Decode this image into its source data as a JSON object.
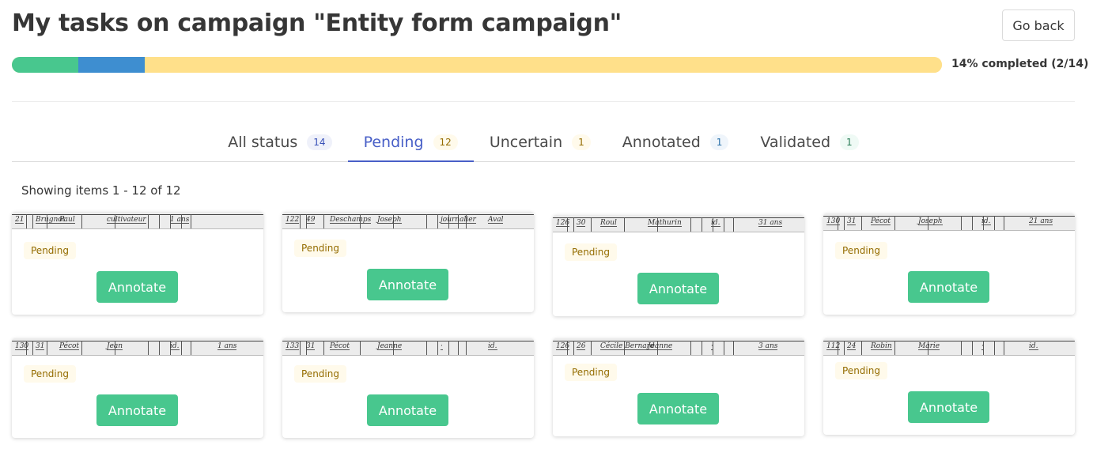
{
  "header": {
    "title": "My tasks on campaign \"Entity form campaign\"",
    "go_back_label": "Go back"
  },
  "progress": {
    "label": "14% completed (2/14)",
    "segments": [
      {
        "status": "validated",
        "count": 1,
        "color": "#48c78e"
      },
      {
        "status": "annotated",
        "count": 1,
        "color": "#3e8ed0"
      },
      {
        "status": "pending",
        "count": 12,
        "color": "#ffe08a"
      }
    ]
  },
  "tabs": [
    {
      "label": "All status",
      "count": "14",
      "active": false,
      "count_bg": "#eff1fa",
      "count_color": "#3850b7"
    },
    {
      "label": "Pending",
      "count": "12",
      "active": true,
      "count_bg": "#fffaeb",
      "count_color": "#946c00"
    },
    {
      "label": "Uncertain",
      "count": "1",
      "active": false,
      "count_bg": "#fffaeb",
      "count_color": "#946c00"
    },
    {
      "label": "Annotated",
      "count": "1",
      "active": false,
      "count_bg": "#eff5fb",
      "count_color": "#296fa8"
    },
    {
      "label": "Validated",
      "count": "1",
      "active": false,
      "count_bg": "#effaf5",
      "count_color": "#257953"
    }
  ],
  "showing_text": "Showing items 1 - 12 of 12",
  "cards": [
    {
      "thumb_text": [
        "21",
        "Brugnot",
        "Paul",
        "cultivateur",
        "1 ans"
      ],
      "status": "Pending",
      "button": "Annotate"
    },
    {
      "thumb_text": [
        "122",
        "49",
        "Deschamps",
        "Joseph",
        "journalier",
        "Aval"
      ],
      "status": "Pending",
      "button": "Annotate"
    },
    {
      "thumb_text": [
        "126",
        "30",
        "Roul",
        "Mathurin",
        "id.",
        "31 ans"
      ],
      "status": "Pending",
      "button": "Annotate"
    },
    {
      "thumb_text": [
        "130",
        "31",
        "Pécot",
        "Joseph",
        "id.",
        "21 ans"
      ],
      "status": "Pending",
      "button": "Annotate"
    },
    {
      "thumb_text": [
        "130",
        "31",
        "Pécot",
        "Jean",
        "id.",
        "1 ans"
      ],
      "status": "Pending",
      "button": "Annotate"
    },
    {
      "thumb_text": [
        "133",
        "31",
        "Pécot",
        "Jeanne",
        "·",
        "id."
      ],
      "status": "Pending",
      "button": "Annotate"
    },
    {
      "thumb_text": [
        "126",
        "26",
        "Cécile Bernard",
        "Jeanne",
        "·",
        "3 ans"
      ],
      "status": "Pending",
      "button": "Annotate"
    },
    {
      "thumb_text": [
        "112",
        "24",
        "Robin",
        "Marie",
        "·",
        "id."
      ],
      "status": "Pending",
      "button": "Annotate"
    }
  ]
}
